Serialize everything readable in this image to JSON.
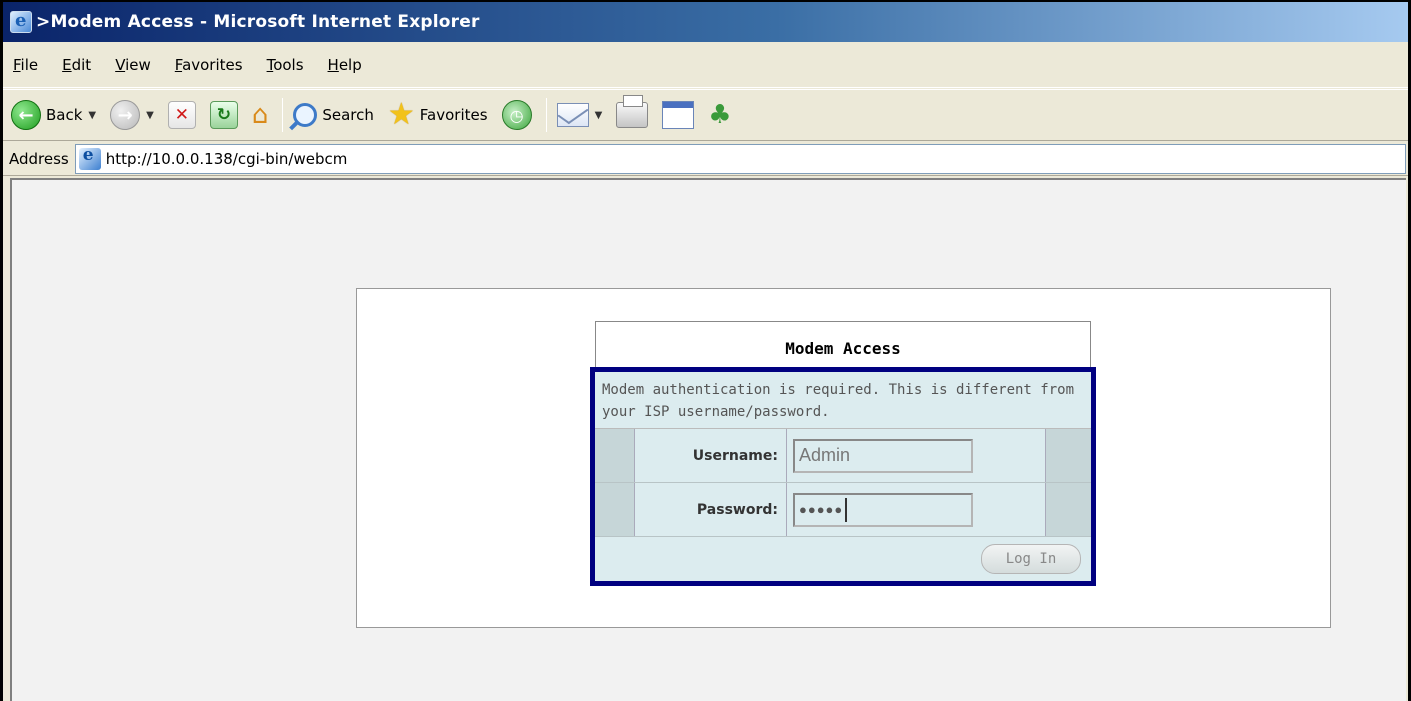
{
  "window": {
    "title": ">Modem Access - Microsoft Internet Explorer"
  },
  "menu": {
    "items": [
      "File",
      "Edit",
      "View",
      "Favorites",
      "Tools",
      "Help"
    ]
  },
  "toolbar": {
    "back_label": "Back",
    "search_label": "Search",
    "favorites_label": "Favorites"
  },
  "address": {
    "label": "Address",
    "url": "http://10.0.0.138/cgi-bin/webcm"
  },
  "login": {
    "heading": "Modem Access",
    "description": "Modem authentication is required. This is different from your ISP username/password.",
    "username_label": "Username:",
    "username_value": "Admin",
    "password_label": "Password:",
    "password_mask": "●●●●●",
    "submit_label": "Log In"
  },
  "colors": {
    "title_bar": "#0a246a",
    "focus_border": "#000080",
    "form_bg": "#dcecef"
  }
}
